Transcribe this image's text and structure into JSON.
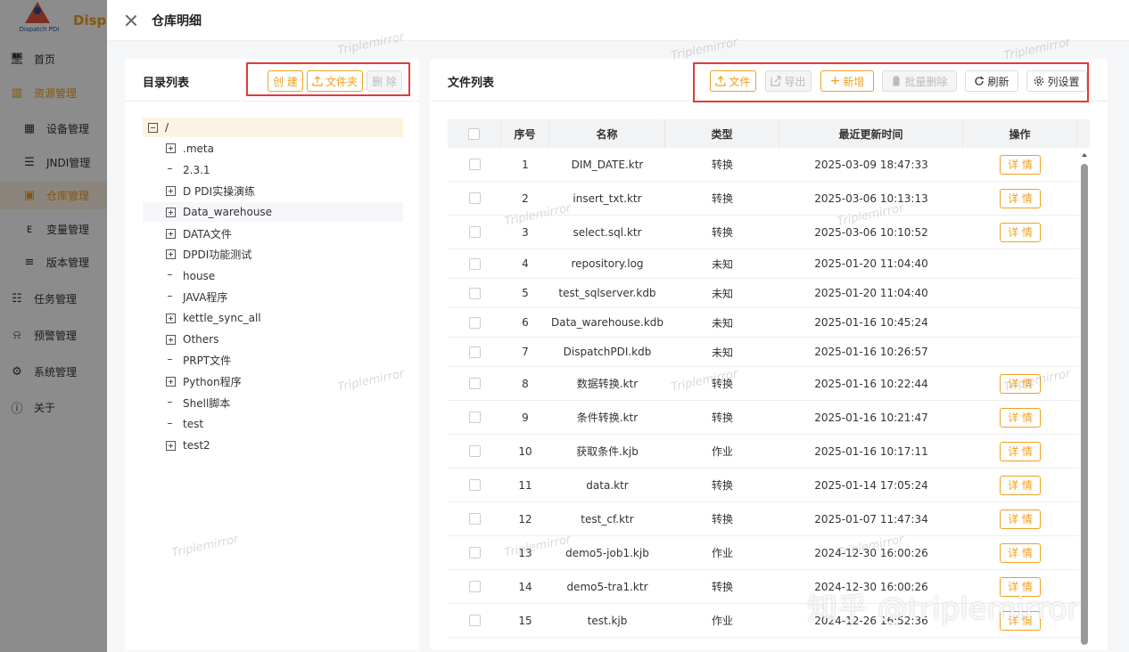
{
  "app": {
    "logo_sub": "Dispatch PDI",
    "brand": "Dispa",
    "menu": [
      {
        "icon": "monitor-icon",
        "glyph": "🖥",
        "label": "首页"
      },
      {
        "icon": "chart-icon",
        "glyph": "▥",
        "label": "资源管理"
      },
      {
        "icon": "server-icon",
        "glyph": "▦",
        "label": "设备管理"
      },
      {
        "icon": "database-icon",
        "glyph": "☰",
        "label": "JNDI管理"
      },
      {
        "icon": "warehouse-icon",
        "glyph": "▣",
        "label": "仓库管理"
      },
      {
        "icon": "env-icon",
        "glyph": "ᴇ",
        "label": "变量管理"
      },
      {
        "icon": "list-icon",
        "glyph": "≡",
        "label": "版本管理"
      },
      {
        "icon": "task-icon",
        "glyph": "☷",
        "label": "任务管理"
      },
      {
        "icon": "alarm-icon",
        "glyph": "⍾",
        "label": "预警管理"
      },
      {
        "icon": "system-icon",
        "glyph": "⚙",
        "label": "系统管理"
      },
      {
        "icon": "info-icon",
        "glyph": "ⓘ",
        "label": "关于"
      }
    ]
  },
  "drawer": {
    "title": "仓库明细",
    "left": {
      "title": "目录列表",
      "buttons": {
        "create": "创 建",
        "folder": "文件夹",
        "delete": "删 除"
      },
      "tree": [
        {
          "label": "/",
          "toggle": "minus",
          "level": 0
        },
        {
          "label": ".meta",
          "toggle": "plus",
          "level": 1
        },
        {
          "label": "2.3.1",
          "toggle": "none",
          "level": 1
        },
        {
          "label": "D PDI实操演练",
          "toggle": "plus",
          "level": 1
        },
        {
          "label": "Data_warehouse",
          "toggle": "plus",
          "level": 1
        },
        {
          "label": "DATA文件",
          "toggle": "plus",
          "level": 1
        },
        {
          "label": "DPDI功能测试",
          "toggle": "plus",
          "level": 1
        },
        {
          "label": "house",
          "toggle": "none",
          "level": 1
        },
        {
          "label": "JAVA程序",
          "toggle": "none",
          "level": 1
        },
        {
          "label": "kettle_sync_all",
          "toggle": "plus",
          "level": 1
        },
        {
          "label": "Others",
          "toggle": "plus",
          "level": 1
        },
        {
          "label": "PRPT文件",
          "toggle": "none",
          "level": 1
        },
        {
          "label": "Python程序",
          "toggle": "plus",
          "level": 1
        },
        {
          "label": "Shell脚本",
          "toggle": "none",
          "level": 1
        },
        {
          "label": "test",
          "toggle": "none",
          "level": 1
        },
        {
          "label": "test2",
          "toggle": "plus",
          "level": 1
        }
      ]
    },
    "right": {
      "title": "文件列表",
      "buttons": {
        "file": "文件",
        "export": "导出",
        "add": "新增",
        "batch_delete": "批量删除",
        "refresh": "刷新",
        "columns": "列设置"
      },
      "columns": [
        "序号",
        "名称",
        "类型",
        "最近更新时间",
        "操作"
      ],
      "detail_label": "详 情",
      "rows": [
        {
          "no": "1",
          "name": "DIM_DATE.ktr",
          "type": "转换",
          "time": "2025-03-09 18:47:33",
          "detail": true
        },
        {
          "no": "2",
          "name": "insert_txt.ktr",
          "type": "转换",
          "time": "2025-03-06 10:13:13",
          "detail": true
        },
        {
          "no": "3",
          "name": "select.sql.ktr",
          "type": "转换",
          "time": "2025-03-06 10:10:52",
          "detail": true
        },
        {
          "no": "4",
          "name": "repository.log",
          "type": "未知",
          "time": "2025-01-20 11:04:40",
          "detail": false
        },
        {
          "no": "5",
          "name": "test_sqlserver.kdb",
          "type": "未知",
          "time": "2025-01-20 11:04:40",
          "detail": false
        },
        {
          "no": "6",
          "name": "Data_warehouse.kdb",
          "type": "未知",
          "time": "2025-01-16 10:45:24",
          "detail": false
        },
        {
          "no": "7",
          "name": "DispatchPDI.kdb",
          "type": "未知",
          "time": "2025-01-16 10:26:57",
          "detail": false
        },
        {
          "no": "8",
          "name": "数据转换.ktr",
          "type": "转换",
          "time": "2025-01-16 10:22:44",
          "detail": true
        },
        {
          "no": "9",
          "name": "条件转换.ktr",
          "type": "转换",
          "time": "2025-01-16 10:21:47",
          "detail": true
        },
        {
          "no": "10",
          "name": "获取条件.kjb",
          "type": "作业",
          "time": "2025-01-16 10:17:11",
          "detail": true
        },
        {
          "no": "11",
          "name": "data.ktr",
          "type": "转换",
          "time": "2025-01-14 17:05:24",
          "detail": true
        },
        {
          "no": "12",
          "name": "test_cf.ktr",
          "type": "转换",
          "time": "2025-01-07 11:47:34",
          "detail": true
        },
        {
          "no": "13",
          "name": "demo5-job1.kjb",
          "type": "作业",
          "time": "2024-12-30 16:00:26",
          "detail": true
        },
        {
          "no": "14",
          "name": "demo5-tra1.ktr",
          "type": "转换",
          "time": "2024-12-30 16:00:26",
          "detail": true
        },
        {
          "no": "15",
          "name": "test.kjb",
          "type": "作业",
          "time": "2024-12-26 16:52:36",
          "detail": true
        }
      ]
    }
  },
  "watermark": {
    "text": "Triplemirror",
    "zhihu": "知乎 @triplemirror"
  },
  "colors": {
    "accent": "#f0a020",
    "highlight_box": "#e53935"
  }
}
